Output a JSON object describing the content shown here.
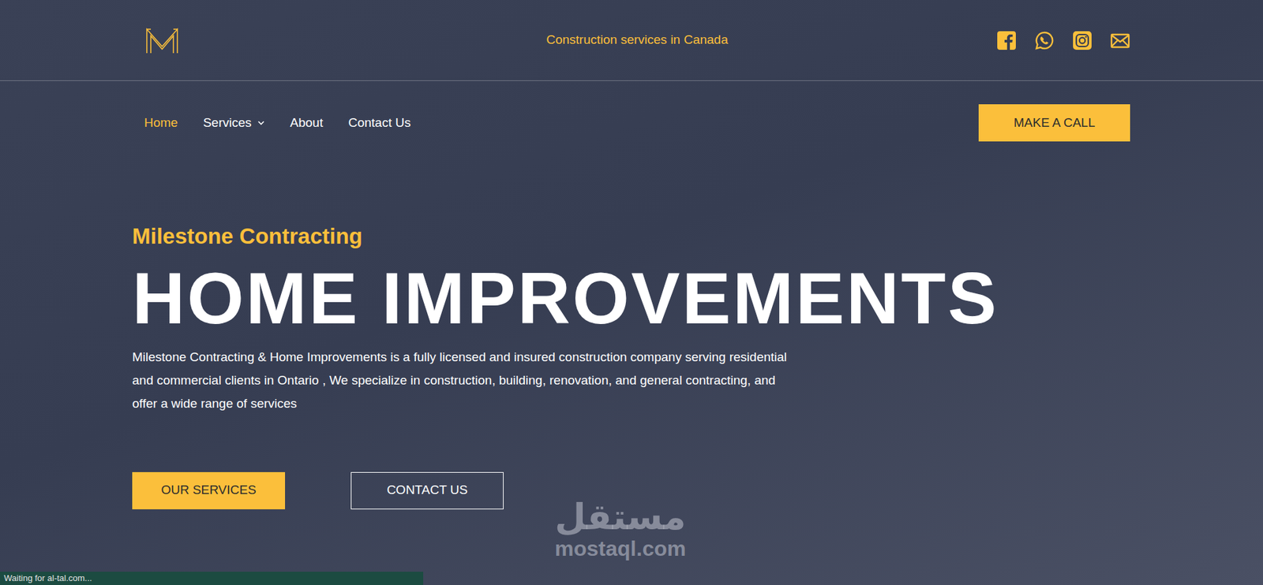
{
  "header": {
    "tagline": "Construction services in Canada"
  },
  "nav": {
    "items": [
      {
        "label": "Home",
        "selected": true,
        "has_menu": false
      },
      {
        "label": "Services",
        "selected": false,
        "has_menu": true
      },
      {
        "label": "About",
        "selected": false,
        "has_menu": false
      },
      {
        "label": "Contact Us",
        "selected": false,
        "has_menu": false
      }
    ],
    "call_button": "MAKE A CALL"
  },
  "hero": {
    "eyebrow": "Milestone Contracting",
    "title": "HOME IMPROVEMENTS",
    "description": "Milestone Contracting & Home Improvements is a fully licensed and insured construction company serving residential and commercial clients in Ontario , We specialize in construction, building, renovation, and general contracting, and offer a wide range of services",
    "buttons": [
      {
        "label": "OUR SERVICES",
        "kind": "solid"
      },
      {
        "label": "CONTACT US",
        "kind": "outline"
      }
    ]
  },
  "watermark": {
    "arabic": "مستقل",
    "latin": "mostaql.com"
  },
  "status_bar": "Waiting for al-tal.com..."
}
